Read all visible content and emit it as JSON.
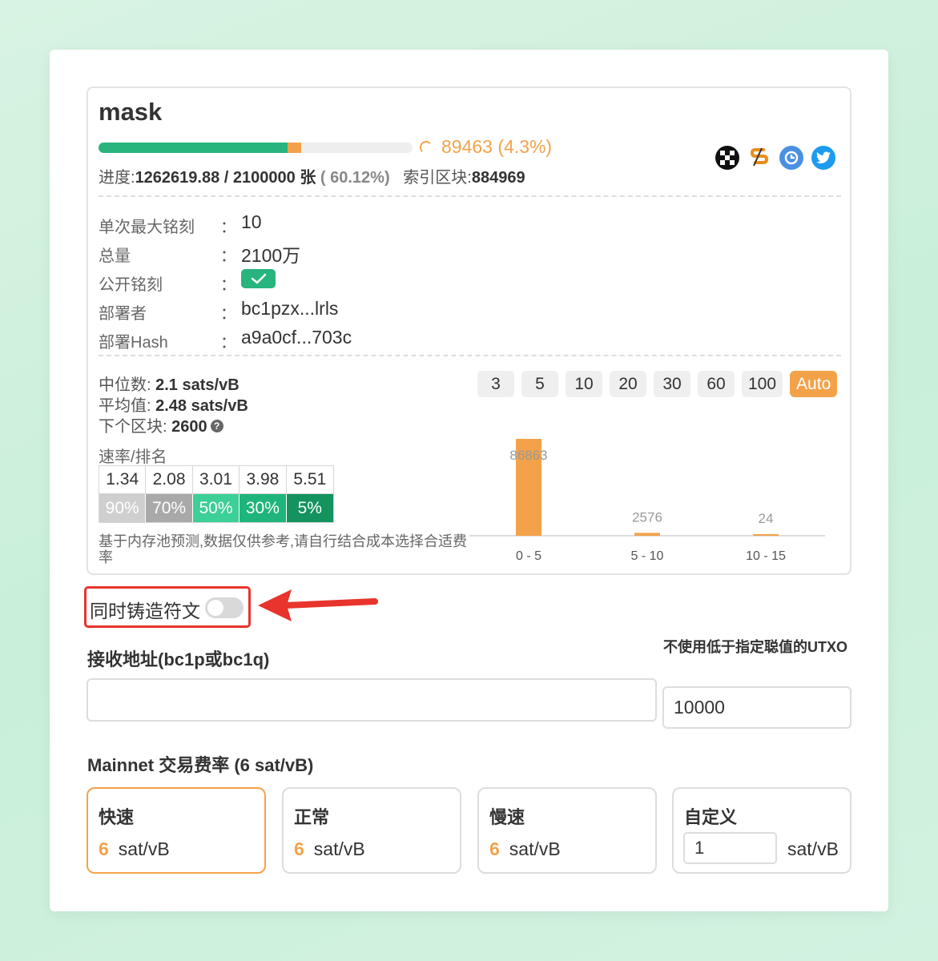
{
  "token": {
    "name": "mask",
    "progress_fraction": 0.6012,
    "pending_fraction": 0.043,
    "pending_text": "89463 (4.3%)",
    "progress_label": "进度:",
    "progress_value": "1262619.88 / 2100000 张",
    "progress_pct": "( 60.12%)",
    "index_label": "索引区块:",
    "index_value": "884969",
    "social_icons": [
      "okx-icon",
      "chain-icon",
      "explorer-icon",
      "twitter-icon"
    ]
  },
  "info": {
    "rows": [
      {
        "label": "单次最大铭刻",
        "colon": "：",
        "value": "10"
      },
      {
        "label": "总量",
        "colon": "：",
        "value": "2100万"
      },
      {
        "label": "公开铭刻",
        "colon": "：",
        "value": ""
      },
      {
        "label": "部署者",
        "colon": "：",
        "value": "bc1pzx...lrls"
      },
      {
        "label": "部署Hash",
        "colon": "：",
        "value": "a9a0cf...703c"
      }
    ]
  },
  "mempool": {
    "median_label": "中位数:",
    "median_value": "2.1 sats/vB",
    "average_label": "平均值:",
    "average_value": "2.48 sats/vB",
    "next_block_label": "下个区块:",
    "next_block_value": "2600",
    "help_glyph": "?",
    "rate_rank_label": "速率/排名",
    "rates": [
      "1.34",
      "2.08",
      "3.01",
      "3.98",
      "5.51"
    ],
    "ranks": [
      "90%",
      "70%",
      "50%",
      "30%",
      "5%"
    ],
    "rank_colors": [
      "#cfcfcf",
      "#a9a9a9",
      "#3ccf96",
      "#1fb47a",
      "#14935f"
    ],
    "note": "基于内存池预测,数据仅供参考,请自行结合成本选择合适费率",
    "fee_buttons": [
      "3",
      "5",
      "10",
      "20",
      "30",
      "60",
      "100",
      "Auto"
    ],
    "active_fee_button": "Auto"
  },
  "chart_data": {
    "type": "bar",
    "categories": [
      "0 - 5",
      "5 - 10",
      "10 - 15"
    ],
    "values": [
      86863,
      2576,
      24
    ],
    "data_labels": [
      "86863",
      "2576",
      "24"
    ],
    "bar_color": "#f3a24a"
  },
  "mint_rune": {
    "label": "同时铸造符文",
    "enabled": false
  },
  "form": {
    "receive_label": "接收地址(bc1p或bc1q)",
    "receive_value": "",
    "utxo_label": "不使用低于指定聪值的UTXO",
    "utxo_value": "10000",
    "fee_title": "Mainnet 交易费率 (6 sat/vB)"
  },
  "fee_options": [
    {
      "title": "快速",
      "value": "6",
      "unit": "sat/vB",
      "selected": true
    },
    {
      "title": "正常",
      "value": "6",
      "unit": "sat/vB",
      "selected": false
    },
    {
      "title": "慢速",
      "value": "6",
      "unit": "sat/vB",
      "selected": false
    },
    {
      "title": "自定义",
      "value": "1",
      "unit": "sat/vB",
      "selected": false
    }
  ],
  "colors": {
    "accent": "#f3a24a",
    "success": "#27b47d",
    "highlight": "#e8342c"
  }
}
